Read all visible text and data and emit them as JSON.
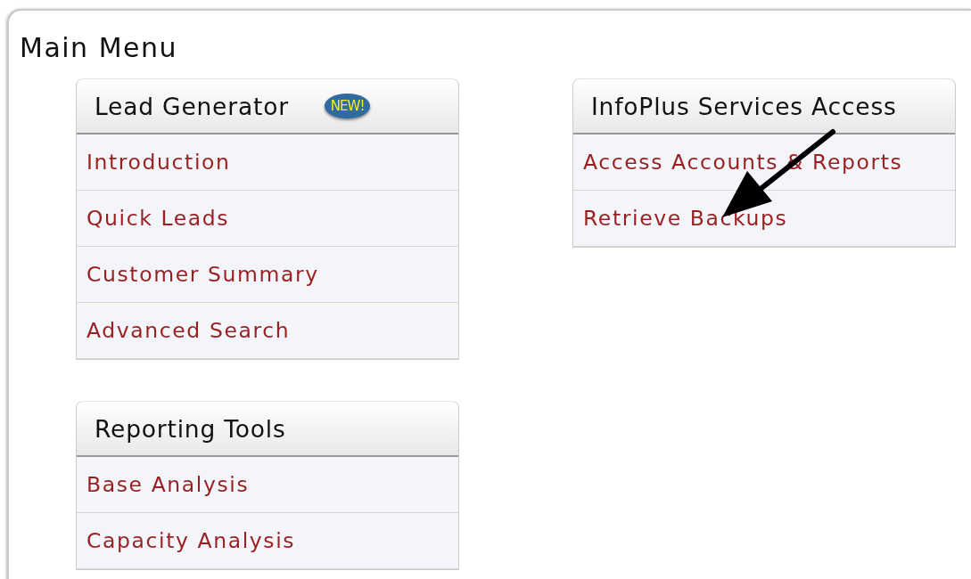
{
  "title": "Main Menu",
  "menus": [
    {
      "title": "Lead Generator",
      "badge": "NEW!",
      "items": [
        "Introduction",
        "Quick Leads",
        "Customer Summary",
        "Advanced Search"
      ]
    },
    {
      "title": "Reporting Tools",
      "items": [
        "Base Analysis",
        "Capacity Analysis"
      ]
    },
    {
      "title": "InfoPlus Services Access",
      "items": [
        "Access Accounts & Reports",
        "Retrieve Backups"
      ]
    }
  ]
}
